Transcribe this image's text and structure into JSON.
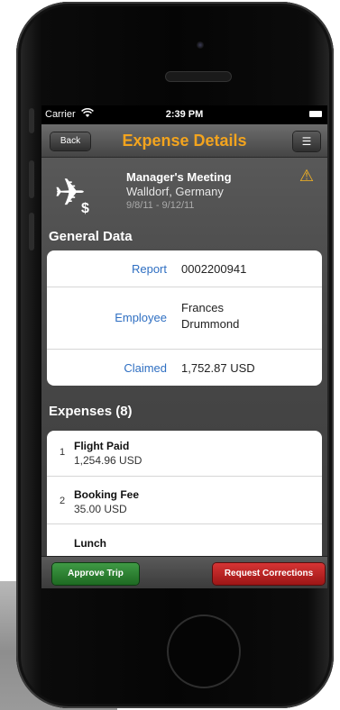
{
  "status_bar": {
    "carrier": "Carrier",
    "wifi_icon": "wifi-icon",
    "time": "2:39 PM",
    "battery_icon": "battery-icon"
  },
  "nav": {
    "back_label": "Back",
    "title": "Expense Details",
    "menu_icon": "menu-icon"
  },
  "trip": {
    "icon": "plane-dollar-icon",
    "plane_glyph": "✈",
    "dollar_glyph": "$",
    "warning_glyph": "⚠",
    "name": "Manager's Meeting",
    "location": "Walldorf, Germany",
    "dates": "9/8/11 - 9/12/11",
    "warning_icon": "warning-icon"
  },
  "general_data": {
    "title": "General Data",
    "rows": [
      {
        "label": "Report",
        "value": "0002200941"
      },
      {
        "label": "Employee",
        "value_line1": "Frances",
        "value_line2": "Drummond"
      },
      {
        "label": "Claimed",
        "value": "1,752.87 USD"
      }
    ]
  },
  "expenses": {
    "title": "Expenses (8)",
    "items": [
      {
        "num": "1",
        "title": "Flight Paid",
        "amount": "1,254.96 USD"
      },
      {
        "num": "2",
        "title": "Booking Fee",
        "amount": "35.00 USD"
      },
      {
        "num": "",
        "title": "Lunch",
        "amount": ""
      }
    ]
  },
  "toolbar": {
    "approve_label": "Approve Trip",
    "request_label": "Request Corrections"
  },
  "colors": {
    "accent_title": "#f3a41e",
    "label_blue": "#2f6fc2",
    "approve_green": "#2e8a34",
    "request_red": "#c42222",
    "warning": "#f5b423"
  }
}
